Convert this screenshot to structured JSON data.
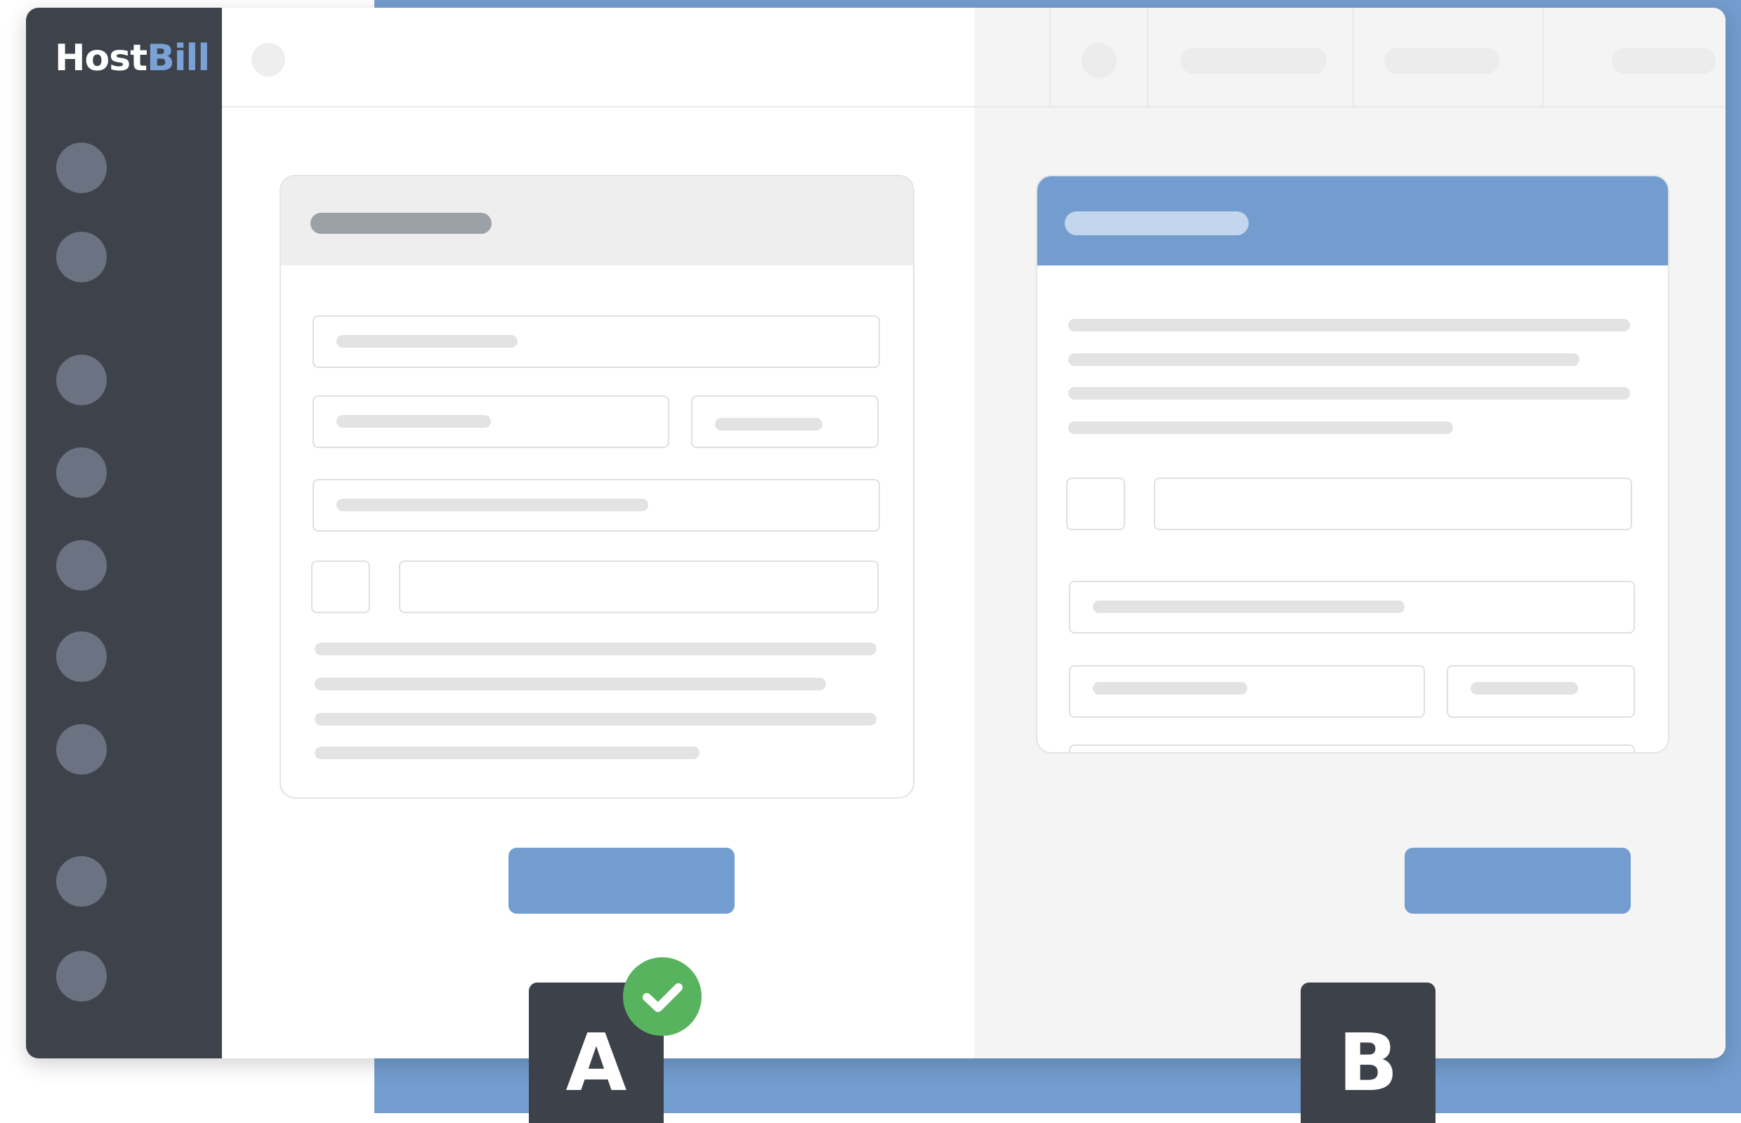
{
  "brand": {
    "host": "Host",
    "bill": "Bill"
  },
  "variants": {
    "a": "A",
    "b": "B"
  },
  "icons": {
    "check": "check-circle-icon",
    "nav": "nav-icon",
    "user": "avatar-icon"
  },
  "colors": {
    "sidebar": "#3e434b",
    "accent": "#739dcf",
    "success": "#58b35e",
    "background_right": "#f3f4f3"
  }
}
